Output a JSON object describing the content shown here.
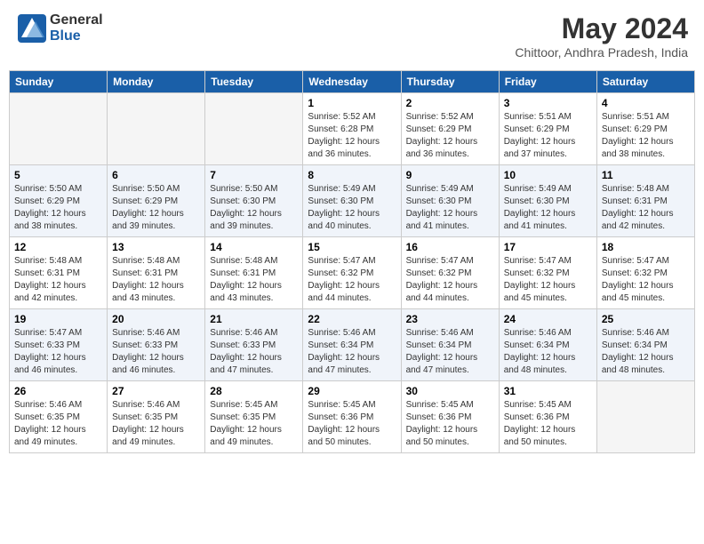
{
  "header": {
    "logo_general": "General",
    "logo_blue": "Blue",
    "month_title": "May 2024",
    "location": "Chittoor, Andhra Pradesh, India"
  },
  "calendar": {
    "days_of_week": [
      "Sunday",
      "Monday",
      "Tuesday",
      "Wednesday",
      "Thursday",
      "Friday",
      "Saturday"
    ],
    "weeks": [
      [
        {
          "day": "",
          "sunrise": "",
          "sunset": "",
          "daylight": "",
          "empty": true
        },
        {
          "day": "",
          "sunrise": "",
          "sunset": "",
          "daylight": "",
          "empty": true
        },
        {
          "day": "",
          "sunrise": "",
          "sunset": "",
          "daylight": "",
          "empty": true
        },
        {
          "day": "1",
          "sunrise": "Sunrise: 5:52 AM",
          "sunset": "Sunset: 6:28 PM",
          "daylight": "Daylight: 12 hours and 36 minutes.",
          "empty": false
        },
        {
          "day": "2",
          "sunrise": "Sunrise: 5:52 AM",
          "sunset": "Sunset: 6:29 PM",
          "daylight": "Daylight: 12 hours and 36 minutes.",
          "empty": false
        },
        {
          "day": "3",
          "sunrise": "Sunrise: 5:51 AM",
          "sunset": "Sunset: 6:29 PM",
          "daylight": "Daylight: 12 hours and 37 minutes.",
          "empty": false
        },
        {
          "day": "4",
          "sunrise": "Sunrise: 5:51 AM",
          "sunset": "Sunset: 6:29 PM",
          "daylight": "Daylight: 12 hours and 38 minutes.",
          "empty": false
        }
      ],
      [
        {
          "day": "5",
          "sunrise": "Sunrise: 5:50 AM",
          "sunset": "Sunset: 6:29 PM",
          "daylight": "Daylight: 12 hours and 38 minutes.",
          "empty": false
        },
        {
          "day": "6",
          "sunrise": "Sunrise: 5:50 AM",
          "sunset": "Sunset: 6:29 PM",
          "daylight": "Daylight: 12 hours and 39 minutes.",
          "empty": false
        },
        {
          "day": "7",
          "sunrise": "Sunrise: 5:50 AM",
          "sunset": "Sunset: 6:30 PM",
          "daylight": "Daylight: 12 hours and 39 minutes.",
          "empty": false
        },
        {
          "day": "8",
          "sunrise": "Sunrise: 5:49 AM",
          "sunset": "Sunset: 6:30 PM",
          "daylight": "Daylight: 12 hours and 40 minutes.",
          "empty": false
        },
        {
          "day": "9",
          "sunrise": "Sunrise: 5:49 AM",
          "sunset": "Sunset: 6:30 PM",
          "daylight": "Daylight: 12 hours and 41 minutes.",
          "empty": false
        },
        {
          "day": "10",
          "sunrise": "Sunrise: 5:49 AM",
          "sunset": "Sunset: 6:30 PM",
          "daylight": "Daylight: 12 hours and 41 minutes.",
          "empty": false
        },
        {
          "day": "11",
          "sunrise": "Sunrise: 5:48 AM",
          "sunset": "Sunset: 6:31 PM",
          "daylight": "Daylight: 12 hours and 42 minutes.",
          "empty": false
        }
      ],
      [
        {
          "day": "12",
          "sunrise": "Sunrise: 5:48 AM",
          "sunset": "Sunset: 6:31 PM",
          "daylight": "Daylight: 12 hours and 42 minutes.",
          "empty": false
        },
        {
          "day": "13",
          "sunrise": "Sunrise: 5:48 AM",
          "sunset": "Sunset: 6:31 PM",
          "daylight": "Daylight: 12 hours and 43 minutes.",
          "empty": false
        },
        {
          "day": "14",
          "sunrise": "Sunrise: 5:48 AM",
          "sunset": "Sunset: 6:31 PM",
          "daylight": "Daylight: 12 hours and 43 minutes.",
          "empty": false
        },
        {
          "day": "15",
          "sunrise": "Sunrise: 5:47 AM",
          "sunset": "Sunset: 6:32 PM",
          "daylight": "Daylight: 12 hours and 44 minutes.",
          "empty": false
        },
        {
          "day": "16",
          "sunrise": "Sunrise: 5:47 AM",
          "sunset": "Sunset: 6:32 PM",
          "daylight": "Daylight: 12 hours and 44 minutes.",
          "empty": false
        },
        {
          "day": "17",
          "sunrise": "Sunrise: 5:47 AM",
          "sunset": "Sunset: 6:32 PM",
          "daylight": "Daylight: 12 hours and 45 minutes.",
          "empty": false
        },
        {
          "day": "18",
          "sunrise": "Sunrise: 5:47 AM",
          "sunset": "Sunset: 6:32 PM",
          "daylight": "Daylight: 12 hours and 45 minutes.",
          "empty": false
        }
      ],
      [
        {
          "day": "19",
          "sunrise": "Sunrise: 5:47 AM",
          "sunset": "Sunset: 6:33 PM",
          "daylight": "Daylight: 12 hours and 46 minutes.",
          "empty": false
        },
        {
          "day": "20",
          "sunrise": "Sunrise: 5:46 AM",
          "sunset": "Sunset: 6:33 PM",
          "daylight": "Daylight: 12 hours and 46 minutes.",
          "empty": false
        },
        {
          "day": "21",
          "sunrise": "Sunrise: 5:46 AM",
          "sunset": "Sunset: 6:33 PM",
          "daylight": "Daylight: 12 hours and 47 minutes.",
          "empty": false
        },
        {
          "day": "22",
          "sunrise": "Sunrise: 5:46 AM",
          "sunset": "Sunset: 6:34 PM",
          "daylight": "Daylight: 12 hours and 47 minutes.",
          "empty": false
        },
        {
          "day": "23",
          "sunrise": "Sunrise: 5:46 AM",
          "sunset": "Sunset: 6:34 PM",
          "daylight": "Daylight: 12 hours and 47 minutes.",
          "empty": false
        },
        {
          "day": "24",
          "sunrise": "Sunrise: 5:46 AM",
          "sunset": "Sunset: 6:34 PM",
          "daylight": "Daylight: 12 hours and 48 minutes.",
          "empty": false
        },
        {
          "day": "25",
          "sunrise": "Sunrise: 5:46 AM",
          "sunset": "Sunset: 6:34 PM",
          "daylight": "Daylight: 12 hours and 48 minutes.",
          "empty": false
        }
      ],
      [
        {
          "day": "26",
          "sunrise": "Sunrise: 5:46 AM",
          "sunset": "Sunset: 6:35 PM",
          "daylight": "Daylight: 12 hours and 49 minutes.",
          "empty": false
        },
        {
          "day": "27",
          "sunrise": "Sunrise: 5:46 AM",
          "sunset": "Sunset: 6:35 PM",
          "daylight": "Daylight: 12 hours and 49 minutes.",
          "empty": false
        },
        {
          "day": "28",
          "sunrise": "Sunrise: 5:45 AM",
          "sunset": "Sunset: 6:35 PM",
          "daylight": "Daylight: 12 hours and 49 minutes.",
          "empty": false
        },
        {
          "day": "29",
          "sunrise": "Sunrise: 5:45 AM",
          "sunset": "Sunset: 6:36 PM",
          "daylight": "Daylight: 12 hours and 50 minutes.",
          "empty": false
        },
        {
          "day": "30",
          "sunrise": "Sunrise: 5:45 AM",
          "sunset": "Sunset: 6:36 PM",
          "daylight": "Daylight: 12 hours and 50 minutes.",
          "empty": false
        },
        {
          "day": "31",
          "sunrise": "Sunrise: 5:45 AM",
          "sunset": "Sunset: 6:36 PM",
          "daylight": "Daylight: 12 hours and 50 minutes.",
          "empty": false
        },
        {
          "day": "",
          "sunrise": "",
          "sunset": "",
          "daylight": "",
          "empty": true
        }
      ]
    ]
  }
}
